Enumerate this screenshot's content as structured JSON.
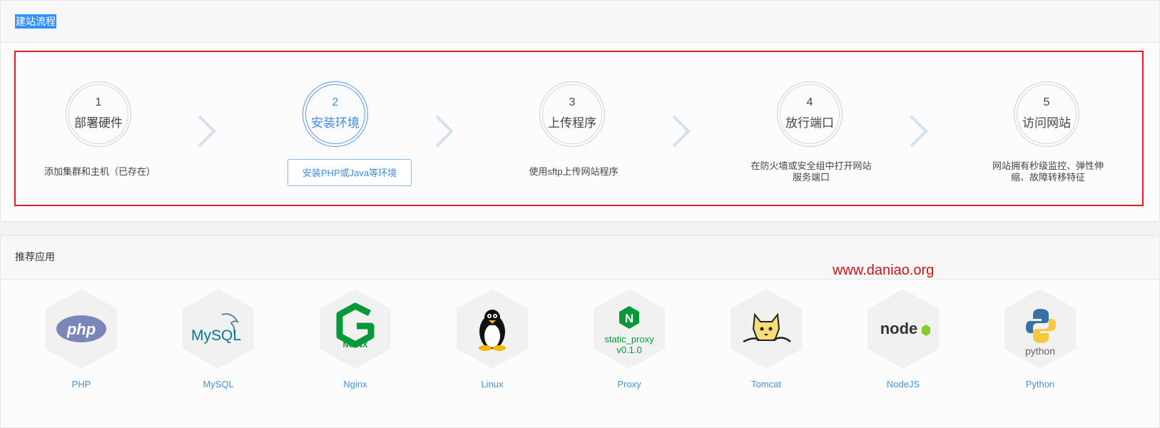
{
  "flow": {
    "title": "建站流程",
    "steps": [
      {
        "num": "1",
        "label": "部署硬件",
        "desc": "添加集群和主机（已存在）"
      },
      {
        "num": "2",
        "label": "安装环境",
        "button": "安装PHP或Java等环境"
      },
      {
        "num": "3",
        "label": "上传程序",
        "desc": "使用sftp上传网站程序"
      },
      {
        "num": "4",
        "label": "放行端口",
        "desc_lines": [
          "在防火墙或安全组中打开网站",
          "服务端口"
        ]
      },
      {
        "num": "5",
        "label": "访问网站",
        "desc_lines": [
          "网站拥有秒级监控、弹性伸",
          "缩、故障转移特征"
        ]
      }
    ]
  },
  "apps": {
    "title": "推荐应用",
    "items": [
      {
        "name": "PHP",
        "icon": "php-logo-icon",
        "logo_text": "php"
      },
      {
        "name": "MySQL",
        "icon": "mysql-logo-icon",
        "logo_text": "MySQL"
      },
      {
        "name": "Nginx",
        "icon": "nginx-logo-icon",
        "logo_text": "NGINX"
      },
      {
        "name": "Linux",
        "icon": "linux-tux-icon"
      },
      {
        "name": "Proxy",
        "icon": "proxy-logo-icon",
        "logo_text": "N",
        "logo_lines": [
          "static_proxy",
          "v0.1.0"
        ]
      },
      {
        "name": "Tomcat",
        "icon": "tomcat-logo-icon"
      },
      {
        "name": "NodeJS",
        "icon": "nodejs-logo-icon",
        "logo_text": "node"
      },
      {
        "name": "Python",
        "icon": "python-logo-icon",
        "logo_text": "python"
      }
    ]
  },
  "watermark": "www.daniao.org",
  "colors": {
    "accent": "#3f8ae0",
    "highlight_border": "#e01b24",
    "watermark": "#d0121b"
  }
}
